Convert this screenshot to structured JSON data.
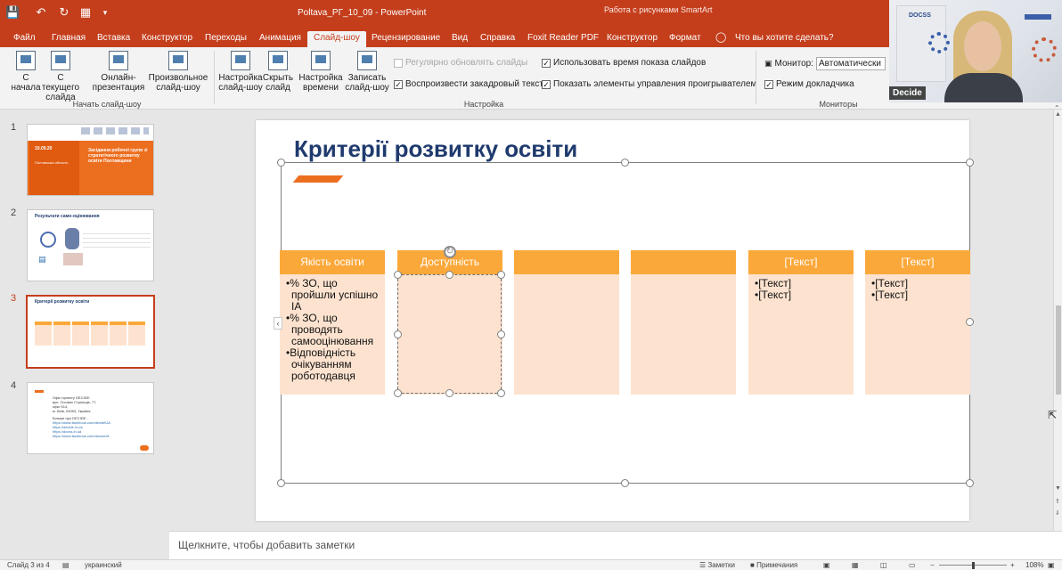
{
  "app": {
    "title": "Poltava_РГ_10_09  -  PowerPoint",
    "contextual_group": "Работа с рисунками SmartArt",
    "search_tell_me": "Что вы хотите сделать?"
  },
  "tabs": [
    {
      "label": "Файл"
    },
    {
      "label": "Главная"
    },
    {
      "label": "Вставка"
    },
    {
      "label": "Конструктор"
    },
    {
      "label": "Переходы"
    },
    {
      "label": "Анимация"
    },
    {
      "label": "Слайд-шоу",
      "active": true
    },
    {
      "label": "Рецензирование"
    },
    {
      "label": "Вид"
    },
    {
      "label": "Справка"
    },
    {
      "label": "Foxit Reader PDF"
    },
    {
      "label": "Конструктор"
    },
    {
      "label": "Формат"
    }
  ],
  "ribbon": {
    "start_group": {
      "label": "Начать слайд-шоу",
      "buttons": [
        {
          "line1": "С",
          "line2": "начала"
        },
        {
          "line1": "С текущего",
          "line2": "слайда"
        },
        {
          "line1": "Онлайн-",
          "line2": "презентация"
        },
        {
          "line1": "Произвольное",
          "line2": "слайд-шоу"
        }
      ]
    },
    "setup_group": {
      "label": "Настройка",
      "buttons": [
        {
          "line1": "Настройка",
          "line2": "слайд-шоу"
        },
        {
          "line1": "Скрыть",
          "line2": "слайд"
        },
        {
          "line1": "Настройка",
          "line2": "времени"
        },
        {
          "line1": "Записать",
          "line2": "слайд-шоу"
        }
      ],
      "checkboxes": [
        {
          "label": "Регулярно обновлять слайды",
          "checked": false,
          "disabled": true
        },
        {
          "label": "Воспроизвести закадровый текст",
          "checked": true
        },
        {
          "label": "Использовать время показа слайдов",
          "checked": true
        },
        {
          "label": "Показать элементы управления проигрывателем",
          "checked": true
        }
      ]
    },
    "monitors_group": {
      "label": "Мониторы",
      "monitor_label": "Монитор:",
      "monitor_value": "Автоматически",
      "presenter_view": "Режим докладчика"
    }
  },
  "webcam": {
    "name": "Decide",
    "logo_text": "DOCSS"
  },
  "thumbnails": [
    {
      "number": "1",
      "date": "10.09.20",
      "region": "Полтавська область",
      "title": "Засідання робочої групи зі стратегічного розвитку освіти Полтавщини"
    },
    {
      "number": "2",
      "title": "Результати само-оцінювання"
    },
    {
      "number": "3",
      "title": "Критерії розвитку освіти",
      "selected": true
    },
    {
      "number": "4",
      "contact_lines": [
        "Офіс проекту DECIDE:",
        "вул. Січових Стрільців, 77,",
        "офіс 514,",
        "м. Київ, 04053, Україна"
      ],
      "more_label": "Більше про DECIDE :",
      "links": [
        "https://www.facebook.com/decideUA",
        "https://decide.in.ua",
        "https://docss.in.ua",
        "https://www.facebook.com/docssUA"
      ]
    }
  ],
  "slide": {
    "title": "Критерії розвитку освіти",
    "columns": [
      {
        "header": "Якість освіти",
        "bullets": [
          "•% ЗО, що пройшли успішно ІА",
          "•% ЗО, що проводять самооцінювання",
          "•Відповідність очікуванням роботодавця"
        ]
      },
      {
        "header": "Доступність",
        "bullets": []
      },
      {
        "header": "",
        "bullets": []
      },
      {
        "header": "",
        "bullets": []
      },
      {
        "header": "[Текст]",
        "bullets": [
          "•[Текст]",
          "•[Текст]"
        ]
      },
      {
        "header": "[Текст]",
        "bullets": [
          "•[Текст]",
          "•[Текст]"
        ]
      }
    ]
  },
  "notes_placeholder": "Щелкните, чтобы добавить заметки",
  "status": {
    "slide_counter": "Слайд 3 из 4",
    "language": "украинский",
    "notes_btn": "Заметки",
    "comments_btn": "Примечания",
    "zoom": "108%"
  }
}
